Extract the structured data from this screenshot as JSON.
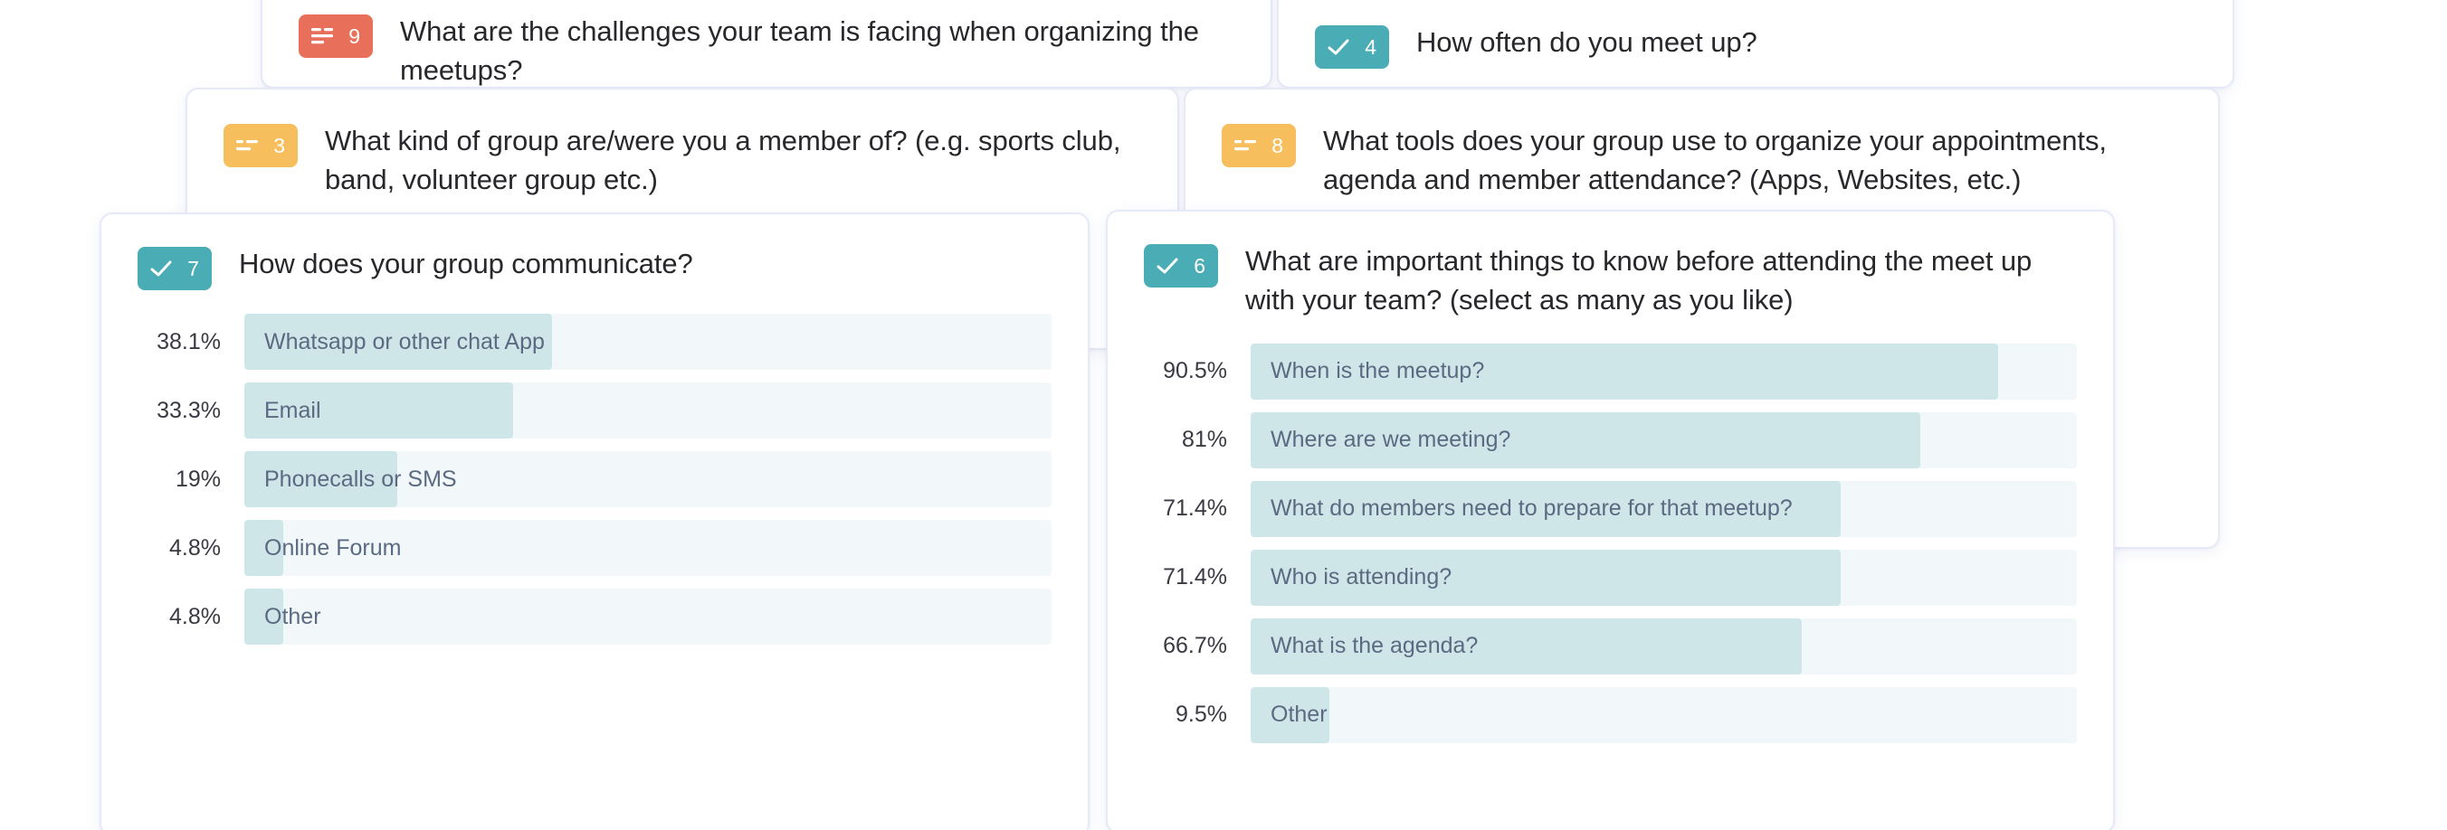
{
  "theme": {
    "page_background": "#ffffff",
    "card_background": "#ffffff",
    "card_border": "#e6e9f7",
    "badge_teal": "#4aadb5",
    "badge_orange": "#e8705a",
    "badge_yellow": "#f6be5c",
    "bar_fill": "#cfe6e8",
    "bar_track": "#f2f8f9",
    "bar_label_text": "#596a82",
    "question_text": "#27272c"
  },
  "cards": {
    "q9": {
      "badge_number": "9",
      "badge_icon": "list-lines-icon",
      "badge_color": "orange",
      "question": "What are the challenges your team is facing when organizing the meetups?"
    },
    "q4": {
      "badge_number": "4",
      "badge_icon": "check-icon",
      "badge_color": "teal",
      "question": "How often do you meet up?"
    },
    "q3": {
      "badge_number": "3",
      "badge_icon": "short-lines-icon",
      "badge_color": "yellow",
      "question": "What kind of group are/were you a member of? (e.g. sports club, band, volunteer group etc.)"
    },
    "q8": {
      "badge_number": "8",
      "badge_icon": "short-lines-icon",
      "badge_color": "yellow",
      "question": "What tools does your group use to organize your appointments, agenda and member attendance? (Apps, Websites, etc.)"
    },
    "q7": {
      "badge_number": "7",
      "badge_icon": "check-icon",
      "badge_color": "teal",
      "question": "How does your group communicate?"
    },
    "q6": {
      "badge_number": "6",
      "badge_icon": "check-icon",
      "badge_color": "teal",
      "question": "What are important things to know before attending the meet up with your team? (select as many as you like)"
    }
  },
  "chart_data": [
    {
      "type": "bar",
      "orientation": "horizontal",
      "title": "How does your group communicate?",
      "card_id": "q7",
      "xlabel": "",
      "ylabel": "",
      "xlim": [
        0,
        100
      ],
      "grid": false,
      "legend": false,
      "categories": [
        "Whatsapp or other chat App",
        "Email",
        "Phonecalls or SMS",
        "Online Forum",
        "Other"
      ],
      "values": [
        38.1,
        33.3,
        19,
        4.8,
        4.8
      ],
      "value_labels": [
        "38.1%",
        "33.3%",
        "19%",
        "4.8%",
        "4.8%"
      ]
    },
    {
      "type": "bar",
      "orientation": "horizontal",
      "title": "What are important things to know before attending the meet up with your team? (select as many as you like)",
      "card_id": "q6",
      "xlabel": "",
      "ylabel": "",
      "xlim": [
        0,
        100
      ],
      "grid": false,
      "legend": false,
      "categories": [
        "When is the meetup?",
        "Where are we meeting?",
        "What do members need to prepare for that meetup?",
        "Who is attending?",
        "What is the agenda?",
        "Other"
      ],
      "values": [
        90.5,
        81,
        71.4,
        71.4,
        66.7,
        9.5
      ],
      "value_labels": [
        "90.5%",
        "81%",
        "71.4%",
        "71.4%",
        "66.7%",
        "9.5%"
      ]
    }
  ]
}
